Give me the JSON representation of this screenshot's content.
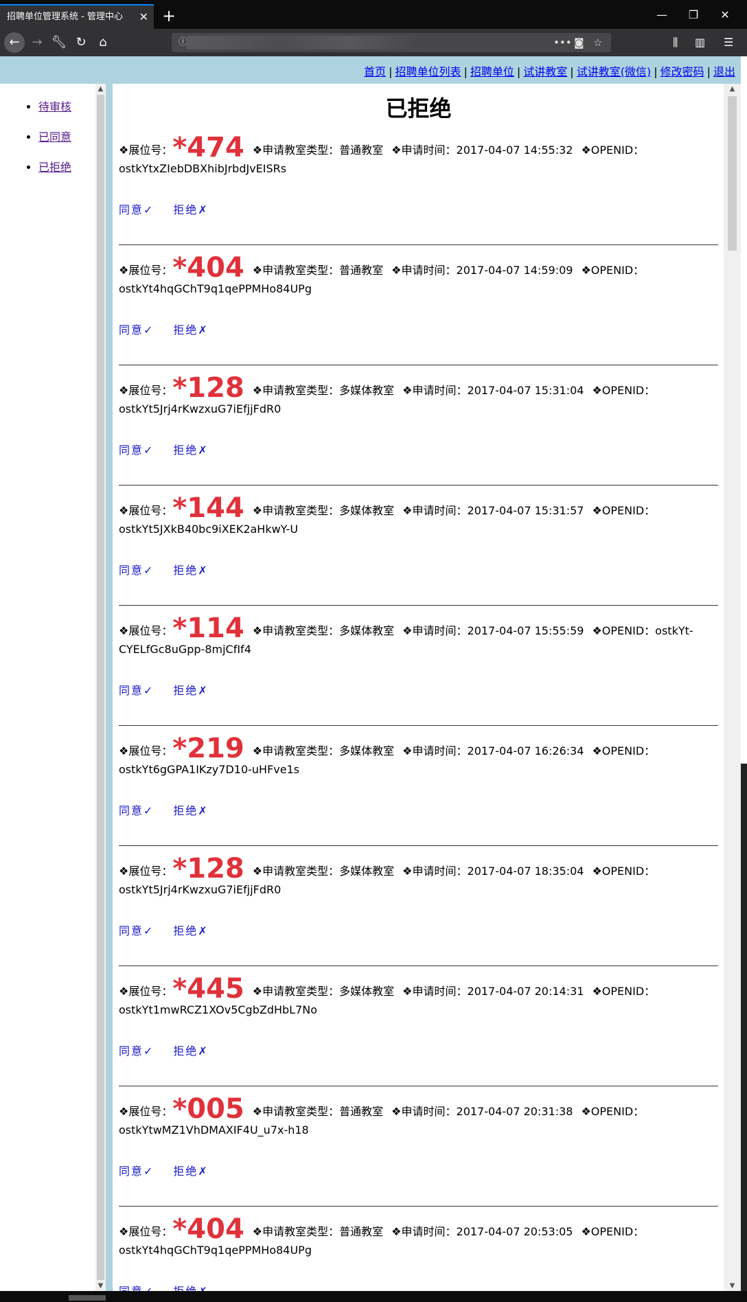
{
  "browser": {
    "tab_title": "招聘单位管理系统 - 管理中心",
    "url_info_icon": "ⓘ"
  },
  "header": {
    "links": [
      "首页",
      "招聘单位列表",
      "招聘单位",
      "试讲教室",
      "试讲教室(微信)",
      "修改密码",
      "退出"
    ],
    "separator": "|"
  },
  "sidebar": {
    "items": [
      {
        "label": "待审核"
      },
      {
        "label": "已同意"
      },
      {
        "label": "已拒绝"
      }
    ]
  },
  "main": {
    "title": "已拒绝",
    "labels": {
      "booth": "❖展位号：",
      "room_type": "❖申请教室类型：",
      "time": "❖申请时间：",
      "openid": "❖OPENID："
    },
    "actions": {
      "approve": "同意✓",
      "reject": "拒绝✗"
    },
    "records": [
      {
        "booth": "*474",
        "room_type": "普通教室",
        "time": "2017-04-07 14:55:32",
        "openid": "ostkYtxZIebDBXhibJrbdJvEISRs"
      },
      {
        "booth": "*404",
        "room_type": "普通教室",
        "time": "2017-04-07 14:59:09",
        "openid": "ostkYt4hqGChT9q1qePPMHo84UPg"
      },
      {
        "booth": "*128",
        "room_type": "多媒体教室",
        "time": "2017-04-07 15:31:04",
        "openid": "ostkYt5Jrj4rKwzxuG7iEfjjFdR0"
      },
      {
        "booth": "*144",
        "room_type": "多媒体教室",
        "time": "2017-04-07 15:31:57",
        "openid": "ostkYt5JXkB40bc9iXEK2aHkwY-U"
      },
      {
        "booth": "*114",
        "room_type": "多媒体教室",
        "time": "2017-04-07 15:55:59",
        "openid": "ostkYt-CYELfGc8uGpp-8mjCfIf4"
      },
      {
        "booth": "*219",
        "room_type": "多媒体教室",
        "time": "2017-04-07 16:26:34",
        "openid": "ostkYt6gGPA1IKzy7D10-uHFve1s"
      },
      {
        "booth": "*128",
        "room_type": "多媒体教室",
        "time": "2017-04-07 18:35:04",
        "openid": "ostkYt5Jrj4rKwzxuG7iEfjjFdR0"
      },
      {
        "booth": "*445",
        "room_type": "多媒体教室",
        "time": "2017-04-07 20:14:31",
        "openid": "ostkYt1mwRCZ1XOv5CgbZdHbL7No"
      },
      {
        "booth": "*005",
        "room_type": "普通教室",
        "time": "2017-04-07 20:31:38",
        "openid": "ostkYtwMZ1VhDMAXIF4U_u7x-h18"
      },
      {
        "booth": "*404",
        "room_type": "普通教室",
        "time": "2017-04-07 20:53:05",
        "openid": "ostkYt4hqGChT9q1qePPMHo84UPg"
      }
    ]
  },
  "colors": {
    "header_bg": "#aed3e0",
    "booth_number": "#e0313a",
    "action_link": "#1a1ac8"
  }
}
